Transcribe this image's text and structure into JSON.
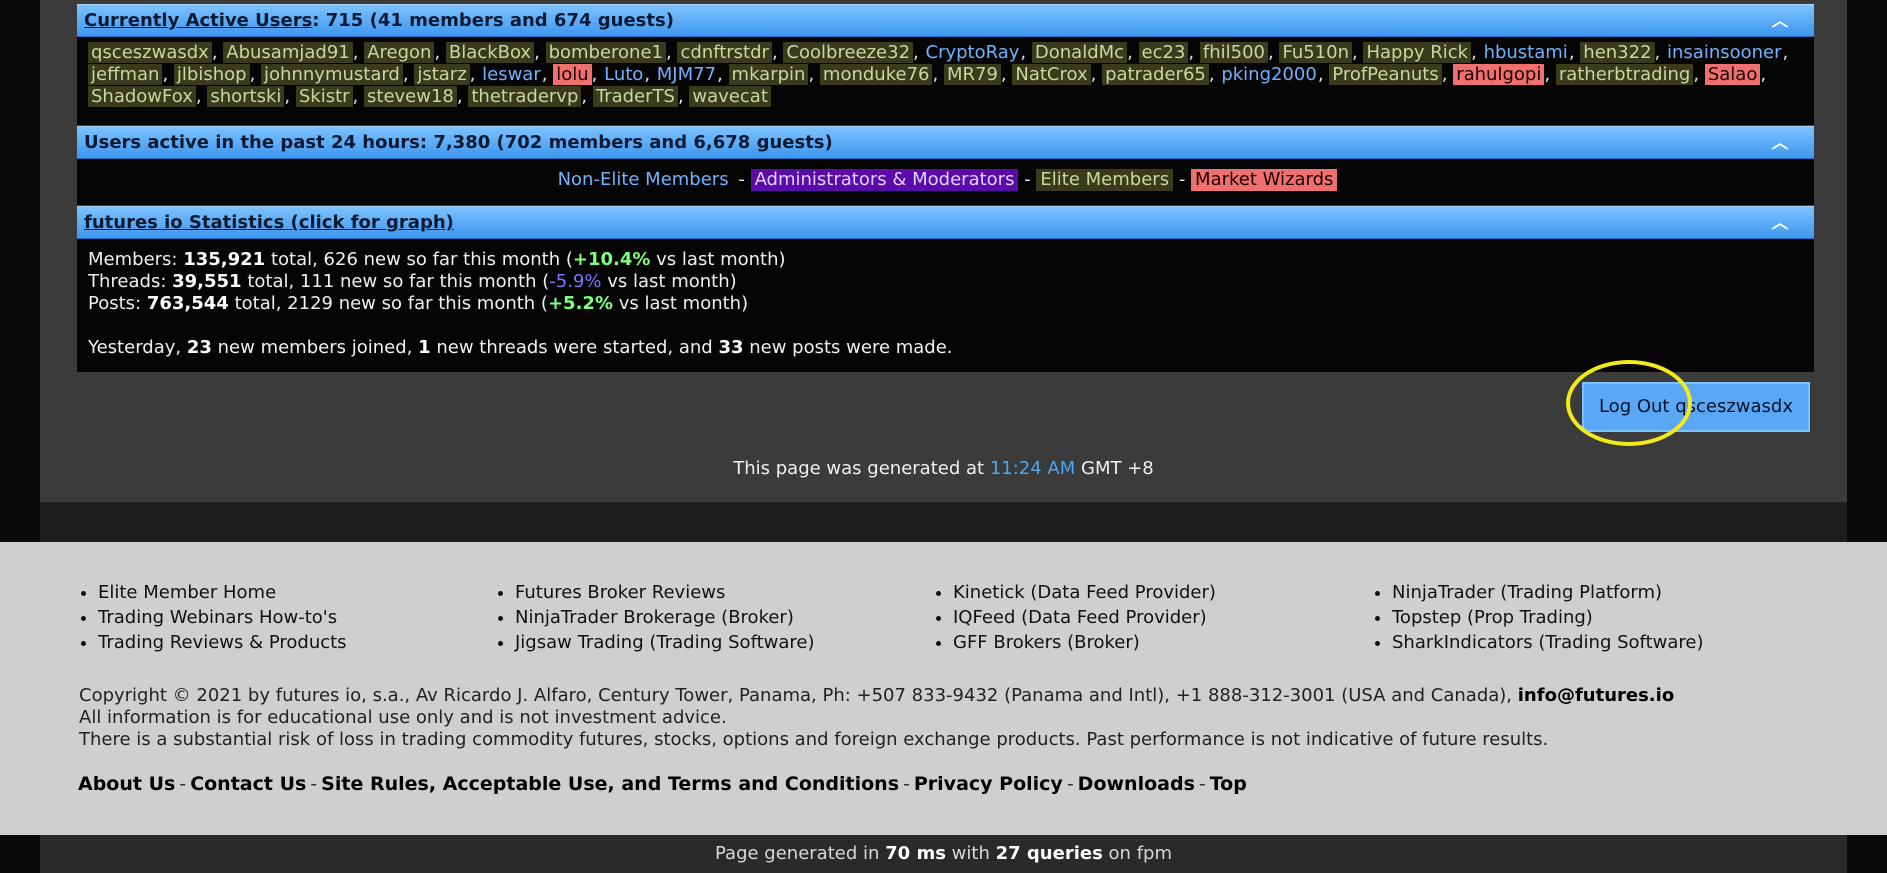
{
  "active_users": {
    "title_link": "Currently Active Users",
    "title_rest": ": 715 (41 members and 674 guests)",
    "collapse_icon": "chevron-up-icon",
    "users": [
      {
        "name": "qsceszwasdx",
        "type": "elite",
        "sep": ","
      },
      {
        "name": "Abusamjad91",
        "type": "elite",
        "sep": ","
      },
      {
        "name": "Aregon",
        "type": "elite",
        "sep": ","
      },
      {
        "name": "BlackBox",
        "type": "elite",
        "sep": ","
      },
      {
        "name": "bomberone1",
        "type": "elite",
        "sep": ","
      },
      {
        "name": "cdnftrstdr",
        "type": "elite",
        "sep": ","
      },
      {
        "name": "Coolbreeze32",
        "type": "elite",
        "sep": ","
      },
      {
        "name": "CryptoRay",
        "type": "nonelite",
        "sep": ","
      },
      {
        "name": "DonaldMc",
        "type": "elite",
        "sep": ","
      },
      {
        "name": "ec23",
        "type": "elite",
        "sep": ","
      },
      {
        "name": "fhil500",
        "type": "elite",
        "sep": ","
      },
      {
        "name": "Fu510n",
        "type": "elite",
        "sep": ","
      },
      {
        "name": "Happy Rick",
        "type": "elite",
        "sep": ","
      },
      {
        "name": "hbustami",
        "type": "nonelite",
        "sep": ","
      },
      {
        "name": "hen322",
        "type": "elite",
        "sep": ","
      },
      {
        "name": "insainsooner",
        "type": "nonelite",
        "sep": ","
      },
      {
        "name": "jeffman",
        "type": "elite",
        "sep": ","
      },
      {
        "name": "jlbishop",
        "type": "elite",
        "sep": ","
      },
      {
        "name": "johnnymustard",
        "type": "elite",
        "sep": ","
      },
      {
        "name": "jstarz",
        "type": "elite",
        "sep": ","
      },
      {
        "name": "leswar",
        "type": "nonelite",
        "sep": ","
      },
      {
        "name": "lolu",
        "type": "wizard",
        "sep": ","
      },
      {
        "name": "Luto",
        "type": "nonelite",
        "sep": ","
      },
      {
        "name": "MJM77",
        "type": "nonelite",
        "sep": ","
      },
      {
        "name": "mkarpin",
        "type": "elite",
        "sep": ","
      },
      {
        "name": "monduke76",
        "type": "elite",
        "sep": ","
      },
      {
        "name": "MR79",
        "type": "elite",
        "sep": ","
      },
      {
        "name": "NatCrox",
        "type": "elite",
        "sep": ","
      },
      {
        "name": "patrader65",
        "type": "elite",
        "sep": ","
      },
      {
        "name": "pking2000",
        "type": "nonelite",
        "sep": ","
      },
      {
        "name": "ProfPeanuts",
        "type": "elite",
        "sep": ","
      },
      {
        "name": "rahulgopi",
        "type": "wizard",
        "sep": ","
      },
      {
        "name": "ratherbtrading",
        "type": "elite",
        "sep": ","
      },
      {
        "name": "Salao",
        "type": "wizard",
        "sep": ","
      },
      {
        "name": "ShadowFox",
        "type": "elite",
        "sep": ","
      },
      {
        "name": "shortski",
        "type": "elite",
        "sep": ","
      },
      {
        "name": "Skistr",
        "type": "elite",
        "sep": ","
      },
      {
        "name": "stevew18",
        "type": "elite",
        "sep": ","
      },
      {
        "name": "thetradervp",
        "type": "elite",
        "sep": ","
      },
      {
        "name": "TraderTS",
        "type": "elite",
        "sep": ","
      },
      {
        "name": "wavecat",
        "type": "elite",
        "sep": ""
      }
    ]
  },
  "past24": {
    "title": "Users active in the past 24 hours: 7,380 (702 members and 6,678 guests)",
    "collapse_icon": "chevron-up-icon"
  },
  "legend": {
    "nonelite": "Non-Elite Members",
    "admin": "Administrators & Moderators",
    "elite": "Elite Members",
    "wizard": "Market Wizards",
    "sep": "-"
  },
  "stats": {
    "title": "futures io Statistics (click for graph)",
    "collapse_icon": "chevron-up-icon",
    "members": {
      "label": "Members:",
      "total": "135,921",
      "mid": "total, 626 new so far this month (",
      "change": "+10.4%",
      "tail": "vs last month)"
    },
    "threads": {
      "label": "Threads:",
      "total": "39,551",
      "mid": "total, 111 new so far this month (",
      "change": "-5.9%",
      "tail": "vs last month)"
    },
    "posts": {
      "label": "Posts:",
      "total": "763,544",
      "mid": "total, 2129 new so far this month (",
      "change": "+5.2%",
      "tail": "vs last month)"
    },
    "yesterday": {
      "t1": "Yesterday,",
      "n1": "23",
      "t2": "new members joined,",
      "n2": "1",
      "t3": "new threads were started, and",
      "n3": "33",
      "t4": "new posts were made."
    }
  },
  "logout": {
    "label": "Log Out qsceszwasdx"
  },
  "generated": {
    "prefix": "This page was generated at",
    "time": "11:24 AM",
    "suffix": "GMT +8"
  },
  "footer": {
    "columns": [
      [
        "Elite Member Home",
        "Trading Webinars How-to's",
        "Trading Reviews & Products"
      ],
      [
        "Futures Broker Reviews",
        "NinjaTrader Brokerage (Broker)",
        "Jigsaw Trading (Trading Software)"
      ],
      [
        "Kinetick (Data Feed Provider)",
        "IQFeed (Data Feed Provider)",
        "GFF Brokers (Broker)"
      ],
      [
        "NinjaTrader (Trading Platform)",
        "Topstep (Prop Trading)",
        "SharkIndicators (Trading Software)"
      ]
    ],
    "copyright": "Copyright © 2021 by futures io, s.a., Av Ricardo J. Alfaro, Century Tower, Panama, Ph: +507 833-9432 (Panama and Intl), +1 888-312-3001 (USA and Canada),",
    "email": "info@futures.io",
    "edu": "All information is for educational use only and is not investment advice.",
    "risk": "There is a substantial risk of loss in trading commodity futures, stocks, options and foreign exchange products. Past performance is not indicative of future results.",
    "links": [
      "About Us",
      "Contact Us",
      "Site Rules, Acceptable Use, and Terms and Conditions",
      "Privacy Policy",
      "Downloads",
      "Top"
    ],
    "link_sep": "-"
  },
  "gen_bar": {
    "prefix": "Page generated in",
    "ms": "70 ms",
    "mid": "with",
    "queries": "27 queries",
    "suffix": "on fpm"
  }
}
